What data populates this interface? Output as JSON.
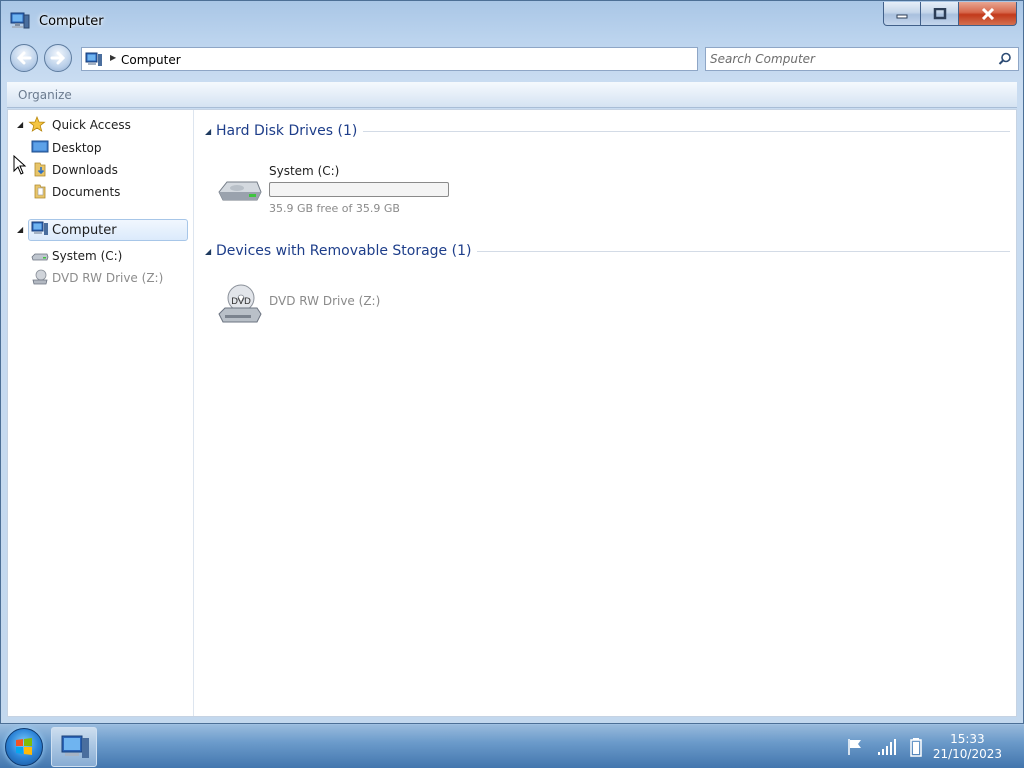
{
  "window": {
    "title": "Computer",
    "icon": "computer-icon",
    "buttons": [
      "minimize-icon",
      "maximize-icon",
      "close-icon"
    ]
  },
  "address": {
    "path": "Computer",
    "search_placeholder": "Search Computer"
  },
  "toolbar": {
    "organize_label": "Organize"
  },
  "sidebar": {
    "quick_access": {
      "label": "Quick Access",
      "items": [
        {
          "label": "Desktop",
          "icon": "desktop-icon"
        },
        {
          "label": "Downloads",
          "icon": "downloads-folder-icon"
        },
        {
          "label": "Documents",
          "icon": "documents-folder-icon"
        }
      ]
    },
    "computer": {
      "label": "Computer",
      "items": [
        {
          "label": "System (C:)",
          "icon": "hard-drive-icon"
        },
        {
          "label": "DVD RW Drive (Z:)",
          "icon": "dvd-drive-icon"
        }
      ]
    }
  },
  "main": {
    "groups": [
      {
        "title": "Hard Disk Drives (1)",
        "drives": [
          {
            "name": "System (C:)",
            "free_text": "35.9 GB free of 35.9 GB",
            "used_fraction": 0.0
          }
        ]
      },
      {
        "title": "Devices with Removable Storage (1)",
        "drives": [
          {
            "name": "DVD RW Drive (Z:)",
            "dvd_label": "DVD"
          }
        ]
      }
    ]
  },
  "taskbar": {
    "clock_time": "15:33",
    "clock_date": "21/10/2023",
    "tray_icons": [
      "action-center-flag-icon",
      "network-signal-icon",
      "battery-icon"
    ]
  }
}
